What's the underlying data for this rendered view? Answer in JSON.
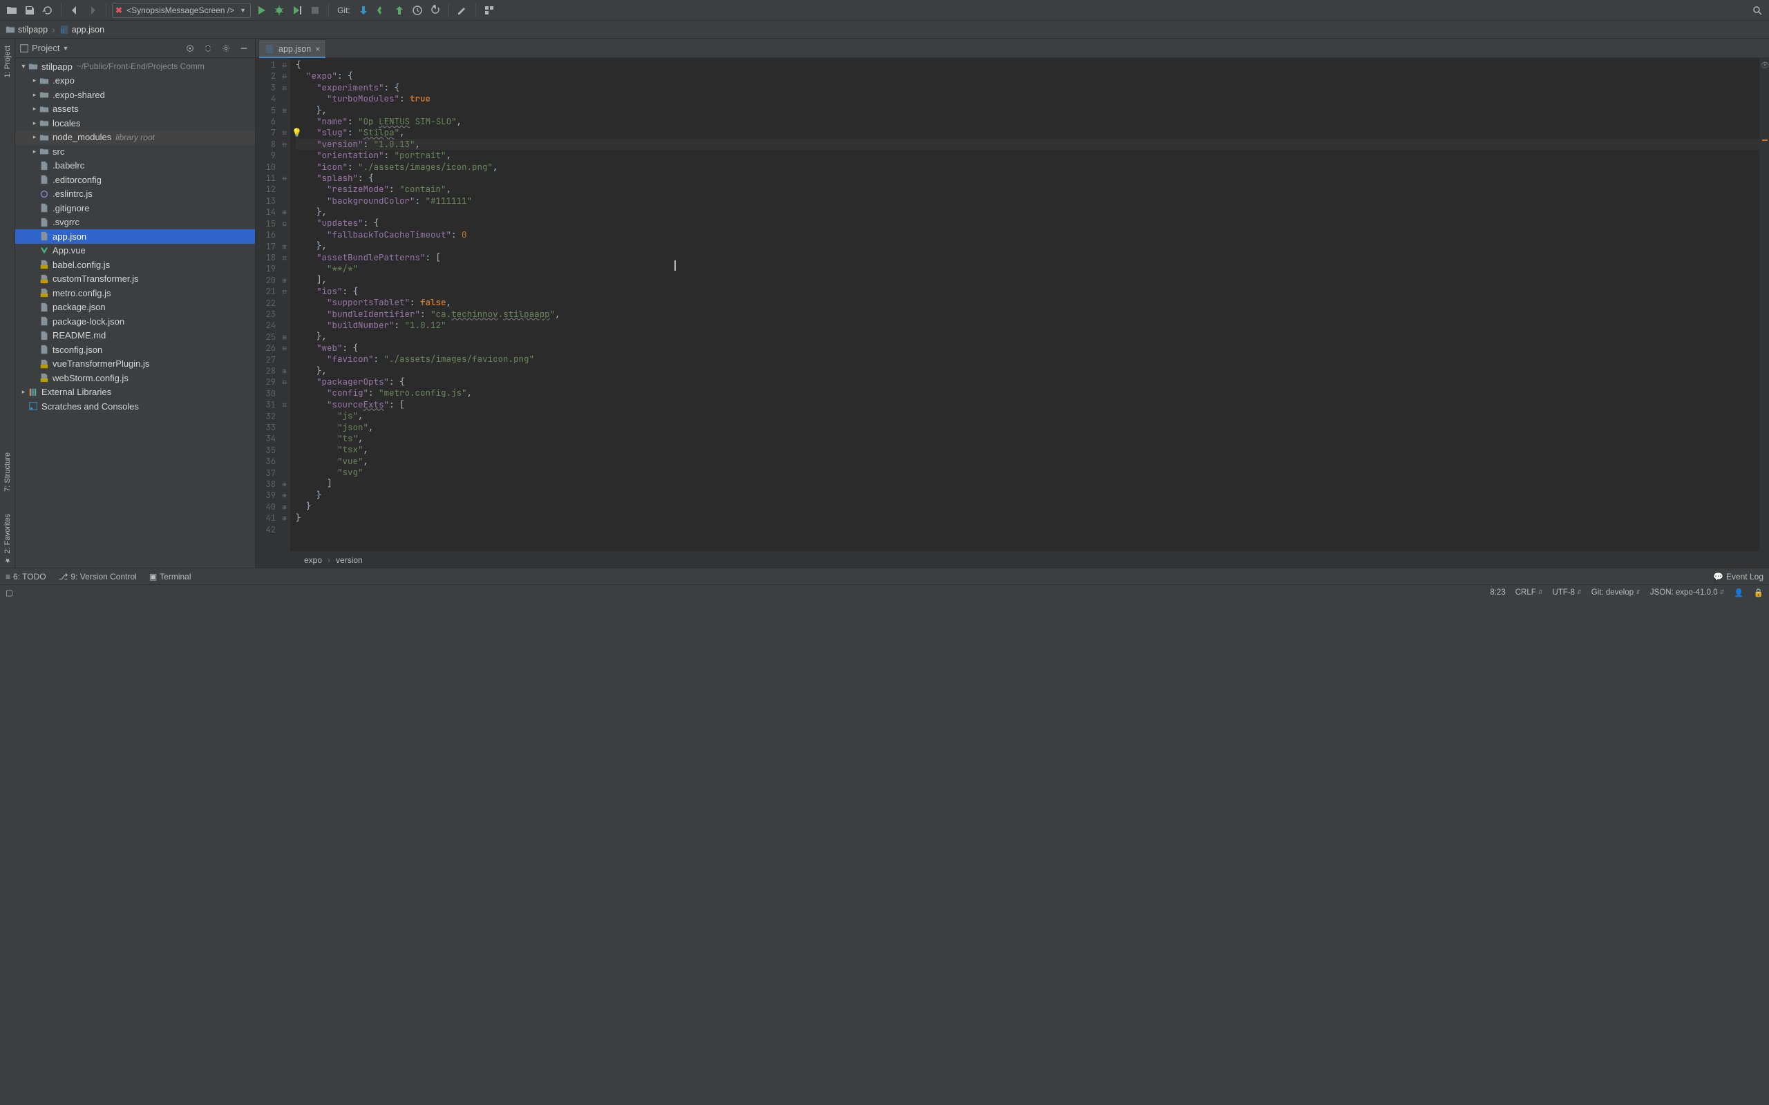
{
  "toolbar": {
    "run_config": "<SynopsisMessageScreen />",
    "git_label": "Git:"
  },
  "breadcrumbs": {
    "project": "stilpapp",
    "file": "app.json"
  },
  "project_panel": {
    "title": "Project",
    "root_name": "stilpapp",
    "root_path": "~/Public/Front-End/Projects Comm",
    "folders": [
      ".expo",
      ".expo-shared",
      "assets",
      "locales",
      "node_modules",
      "src"
    ],
    "node_modules_tag": "library root",
    "files": [
      ".babelrc",
      ".editorconfig",
      ".eslintrc.js",
      ".gitignore",
      ".svgrrc",
      "app.json",
      "App.vue",
      "babel.config.js",
      "customTransformer.js",
      "metro.config.js",
      "package.json",
      "package-lock.json",
      "README.md",
      "tsconfig.json",
      "vueTransformerPlugin.js",
      "webStorm.config.js"
    ],
    "external": "External Libraries",
    "scratches": "Scratches and Consoles"
  },
  "editor": {
    "tab_name": "app.json",
    "breadcrumb1": "expo",
    "breadcrumb2": "version",
    "content": {
      "expo": {
        "experiments": {
          "turboModules": true
        },
        "name": "Op LENTUS SIM-SLO",
        "slug": "Stilpa",
        "version": "1.0.13",
        "orientation": "portrait",
        "icon": "./assets/images/icon.png",
        "splash": {
          "resizeMode": "contain",
          "backgroundColor": "#111111"
        },
        "updates": {
          "fallbackToCacheTimeout": 0
        },
        "assetBundlePatterns": [
          "**/*"
        ],
        "ios": {
          "supportsTablet": false,
          "bundleIdentifier": "ca.techinnov.stilpaapp",
          "buildNumber": "1.0.12"
        },
        "web": {
          "favicon": "./assets/images/favicon.png"
        },
        "packagerOpts": {
          "config": "metro.config.js",
          "sourceExts": [
            "js",
            "json",
            "ts",
            "tsx",
            "vue",
            "svg"
          ]
        }
      }
    }
  },
  "left_tabs": {
    "project": "1: Project",
    "structure": "7: Structure",
    "favorites": "2: Favorites"
  },
  "bottom_tools": {
    "todo": "6: TODO",
    "vcs": "9: Version Control",
    "terminal": "Terminal",
    "event_log": "Event Log"
  },
  "status": {
    "pos": "8:23",
    "line_sep": "CRLF",
    "encoding": "UTF-8",
    "git_branch": "Git: develop",
    "schema": "JSON: expo-41.0.0"
  }
}
